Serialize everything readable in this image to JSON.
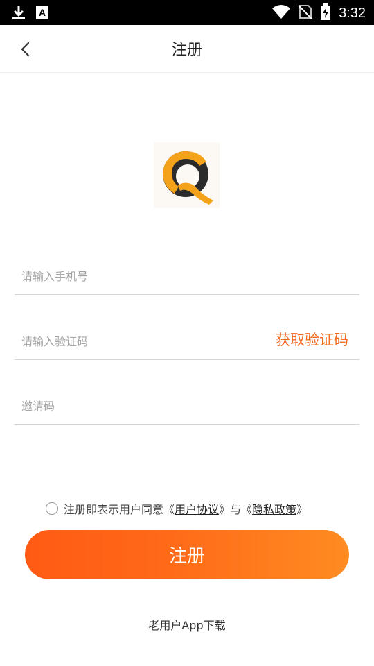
{
  "status_bar": {
    "time": "3:32",
    "left_icons": [
      "download-icon",
      "a-notification-icon"
    ],
    "right_icons": [
      "wifi-icon",
      "no-sim-icon",
      "battery-charging-icon"
    ]
  },
  "header": {
    "back_icon": "chevron-left-icon",
    "title": "注册"
  },
  "logo": {
    "letter": "Q",
    "colors": {
      "ring": "#2b2b2b",
      "accent": "#f5a21b"
    }
  },
  "form": {
    "phone_placeholder": "请输入手机号",
    "code_placeholder": "请输入验证码",
    "get_code_label": "获取验证码",
    "invite_placeholder": "邀请码"
  },
  "agreement": {
    "prefix": "注册即表示用户同意《",
    "user_agreement": "用户协议",
    "middle": "》与《",
    "privacy_policy": "隐私政策",
    "suffix": "》"
  },
  "register_button": "注册",
  "old_user_download": "老用户App下载",
  "colors": {
    "accent": "#f26a1e",
    "button_start": "#ff5a14",
    "button_end": "#ff8c22"
  }
}
